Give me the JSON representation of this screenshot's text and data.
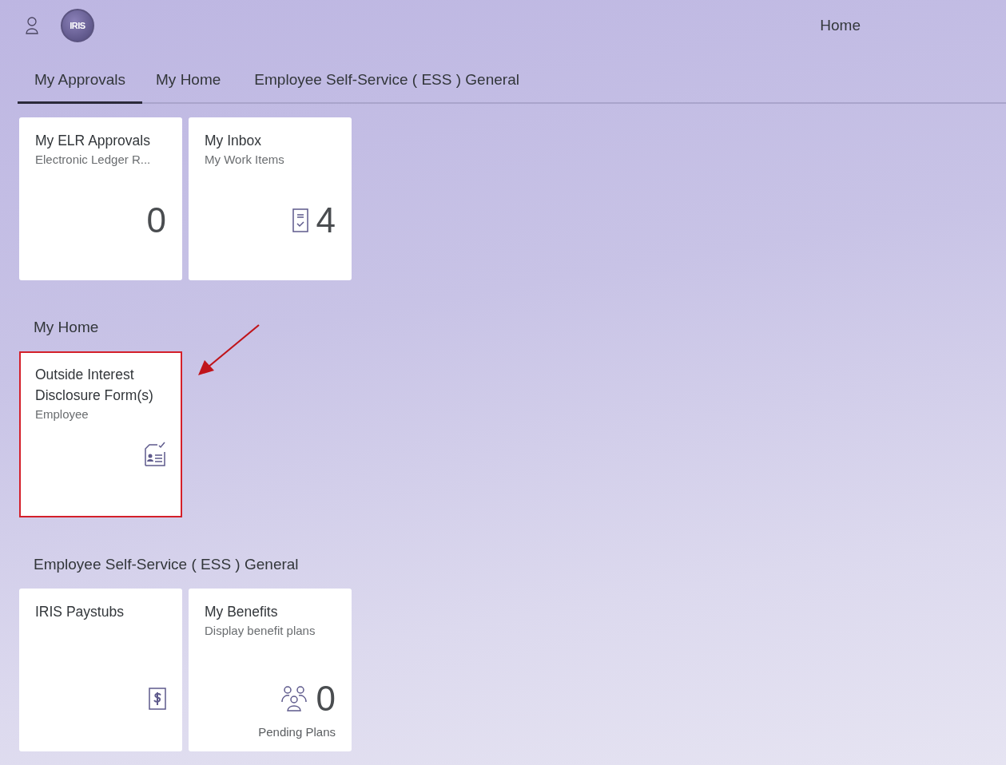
{
  "header": {
    "logo_text": "IRIS",
    "title": "Home"
  },
  "tabs": [
    {
      "label": "My Approvals",
      "selected": true
    },
    {
      "label": "My Home",
      "selected": false
    },
    {
      "label": "Employee Self-Service ( ESS ) General",
      "selected": false
    }
  ],
  "sections": [
    {
      "tiles": [
        {
          "kind": "counter",
          "title": "My ELR Approvals",
          "subtitle": "Electronic Ledger R...",
          "number": "0",
          "highlighted": false
        },
        {
          "kind": "inbox",
          "title": "My Inbox",
          "subtitle": "My Work Items",
          "number": "4",
          "highlighted": false
        }
      ]
    },
    {
      "heading": "My Home",
      "tiles": [
        {
          "kind": "form",
          "title": "Outside Interest Disclosure Form(s)",
          "subtitle": "Employee",
          "highlighted": true,
          "arrow": true
        }
      ]
    },
    {
      "heading": "Employee Self-Service ( ESS ) General",
      "tiles": [
        {
          "kind": "paystub",
          "title": "IRIS Paystubs",
          "highlighted": false
        },
        {
          "kind": "benefits",
          "title": "My Benefits",
          "subtitle": "Display benefit plans",
          "number": "0",
          "footer": "Pending Plans",
          "highlighted": false
        }
      ]
    }
  ]
}
